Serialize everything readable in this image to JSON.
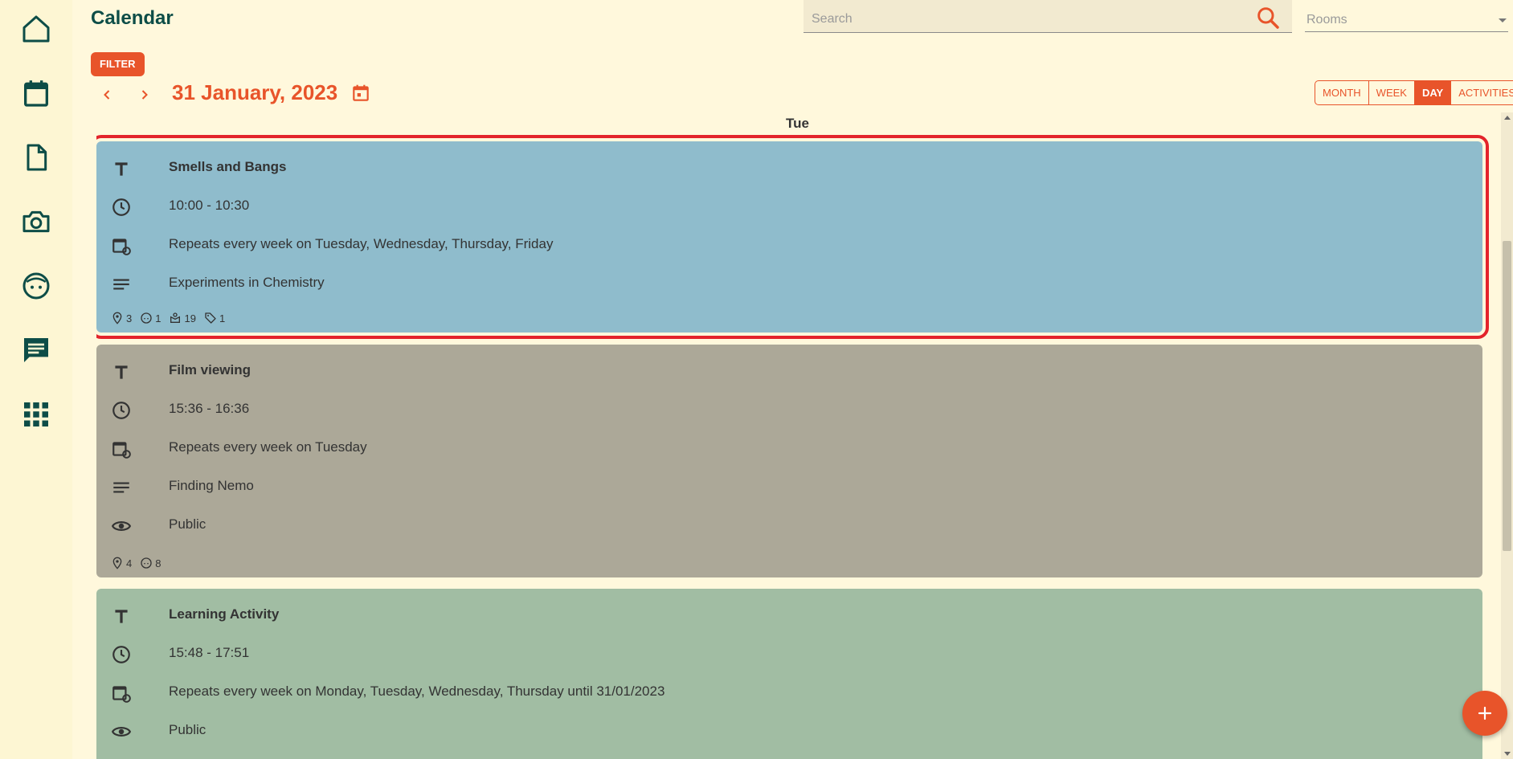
{
  "app": {
    "title": "Calendar"
  },
  "colors": {
    "accent": "#e8542a",
    "brand": "#0d4d47",
    "selected_outline": "#e3242b"
  },
  "sidebar": {
    "items": [
      {
        "icon": "home-icon"
      },
      {
        "icon": "calendar-icon"
      },
      {
        "icon": "document-icon"
      },
      {
        "icon": "camera-icon"
      },
      {
        "icon": "child-face-icon"
      },
      {
        "icon": "chat-icon"
      },
      {
        "icon": "apps-grid-icon"
      }
    ]
  },
  "search": {
    "placeholder": "Search"
  },
  "rooms": {
    "placeholder": "Rooms"
  },
  "toolbar": {
    "filter_label": "FILTER",
    "date": "31 January, 2023",
    "views": [
      "MONTH",
      "WEEK",
      "DAY",
      "ACTIVITIES"
    ],
    "active_view": "DAY"
  },
  "day_header": "Tue",
  "events": [
    {
      "title": "Smells and Bangs",
      "time": "10:00 - 10:30",
      "repeat": "Repeats every week on Tuesday, Wednesday, Thursday, Friday",
      "description": "Experiments in Chemistry",
      "color": "#8fbccc",
      "selected": true,
      "meta": {
        "locations": "3",
        "children": "1",
        "groups": "19",
        "tags": "1"
      }
    },
    {
      "title": "Film viewing",
      "time": "15:36 - 16:36",
      "repeat": "Repeats every week on Tuesday",
      "description": "Finding Nemo",
      "visibility": "Public",
      "color": "#aca898",
      "meta": {
        "locations": "4",
        "children": "8"
      }
    },
    {
      "title": "Learning Activity",
      "time": "15:48 - 17:51",
      "repeat": "Repeats every week on Monday, Tuesday, Wednesday, Thursday until 31/01/2023",
      "visibility": "Public",
      "color": "#a1bda3"
    }
  ],
  "fab": {
    "icon": "plus-icon"
  }
}
